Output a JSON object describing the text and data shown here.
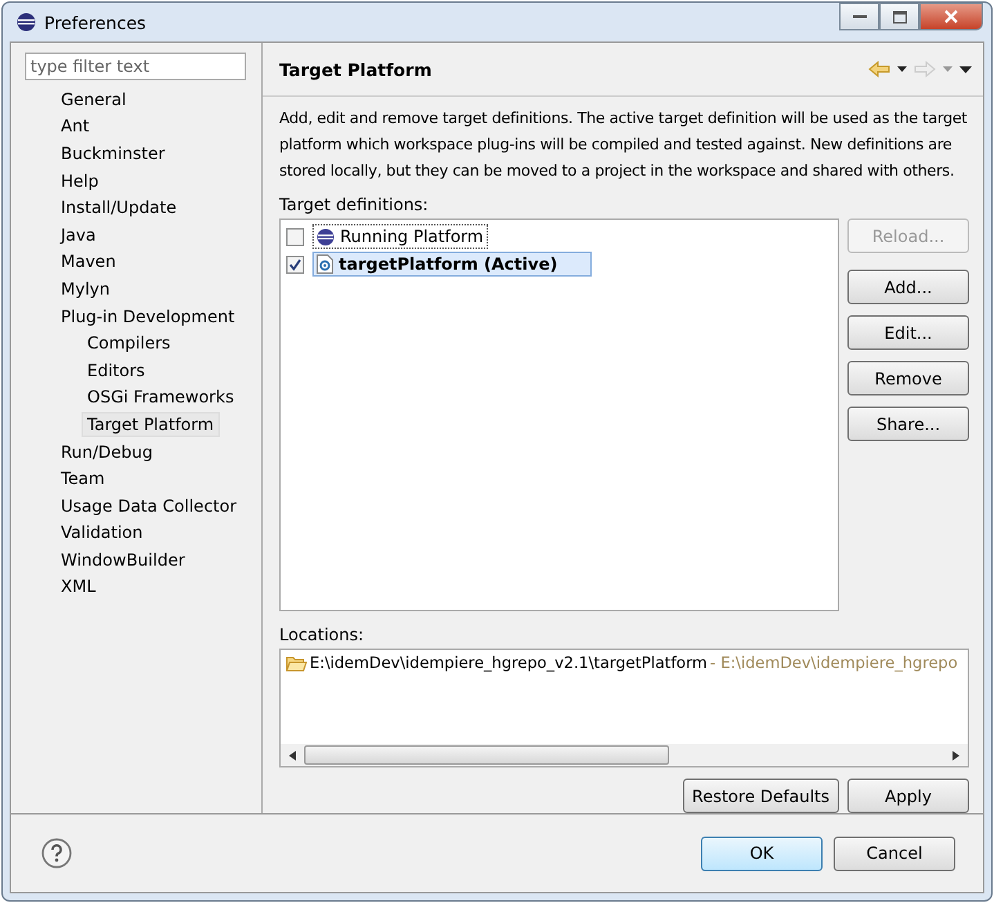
{
  "window": {
    "title": "Preferences"
  },
  "filter": {
    "placeholder": "type filter text"
  },
  "tree": [
    {
      "label": "General",
      "selected": false
    },
    {
      "label": "Ant",
      "selected": false
    },
    {
      "label": "Buckminster",
      "selected": false
    },
    {
      "label": "Help",
      "selected": false
    },
    {
      "label": "Install/Update",
      "selected": false
    },
    {
      "label": "Java",
      "selected": false
    },
    {
      "label": "Maven",
      "selected": false
    },
    {
      "label": "Mylyn",
      "selected": false
    },
    {
      "label": "Plug-in Development",
      "selected": false,
      "children": [
        {
          "label": "Compilers",
          "selected": false
        },
        {
          "label": "Editors",
          "selected": false
        },
        {
          "label": "OSGi Frameworks",
          "selected": false
        },
        {
          "label": "Target Platform",
          "selected": true
        }
      ]
    },
    {
      "label": "Run/Debug",
      "selected": false
    },
    {
      "label": "Team",
      "selected": false
    },
    {
      "label": "Usage Data Collector",
      "selected": false
    },
    {
      "label": "Validation",
      "selected": false
    },
    {
      "label": "WindowBuilder",
      "selected": false
    },
    {
      "label": "XML",
      "selected": false
    }
  ],
  "page": {
    "title": "Target Platform",
    "description": "Add, edit and remove target definitions.  The active target definition will be used as the target platform which workspace plug-ins will be compiled and tested against.  New definitions are stored locally, but they can be moved to a project in the workspace and shared with others."
  },
  "targets": {
    "label": "Target definitions:",
    "items": [
      {
        "label": "Running Platform",
        "kind": "running",
        "checked": false,
        "selected": false,
        "active": false
      },
      {
        "label": "targetPlatform (Active)",
        "kind": "file",
        "checked": true,
        "selected": true,
        "active": true
      }
    ],
    "buttons": [
      {
        "label": "Reload...",
        "disabled": true
      },
      {
        "label": "Add...",
        "disabled": false
      },
      {
        "label": "Edit...",
        "disabled": false
      },
      {
        "label": "Remove",
        "disabled": false
      },
      {
        "label": "Share...",
        "disabled": false
      }
    ]
  },
  "locations": {
    "label": "Locations:",
    "items": [
      {
        "path": "E:\\idemDev\\idempiere_hgrepo_v2.1\\targetPlatform",
        "detail": " - E:\\idemDev\\idempiere_hgrepo"
      }
    ]
  },
  "page_buttons": [
    "Restore Defaults",
    "Apply"
  ],
  "dialog_buttons": [
    {
      "label": "OK",
      "default": true
    },
    {
      "label": "Cancel",
      "default": false
    }
  ]
}
